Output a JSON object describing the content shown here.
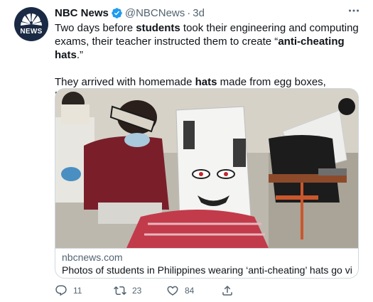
{
  "tweet": {
    "author_name": "NBC News",
    "author_handle": "@NBCNews",
    "separator": "·",
    "time": "3d",
    "avatar_text": "NEWS",
    "more_icon": "more-dots-icon",
    "verified_icon": "verified-badge-icon",
    "verified_color": "#1d9bf0",
    "body": {
      "p1_a": "Two days before ",
      "p1_b": "students",
      "p1_c": " took their engineering and computing exams, their teacher instructed them to create “",
      "p1_d": "anti-cheating hats",
      "p1_e": ".”",
      "p2_a": "They arrived with homemade ",
      "p2_b": "hats",
      "p2_c": " made from egg boxes, Halloween masks, and headgear from cardboard and coat hangers."
    },
    "card": {
      "domain": "nbcnews.com",
      "title": "Photos of students in Philippines wearing ‘anti-cheating’ hats go viral"
    },
    "actions": {
      "replies": "11",
      "retweets": "23",
      "likes": "84",
      "reply_icon": "reply-icon",
      "retweet_icon": "retweet-icon",
      "like_icon": "heart-icon",
      "share_icon": "share-icon"
    }
  }
}
